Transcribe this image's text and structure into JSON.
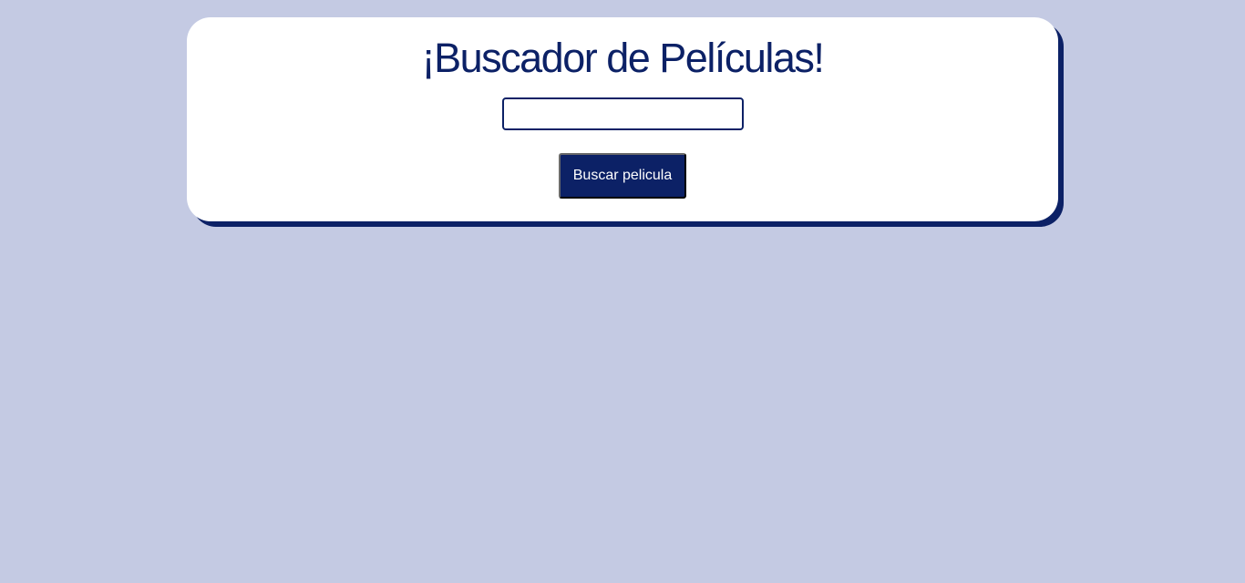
{
  "theme": {
    "background": "#c4cae3",
    "card_background": "#ffffff",
    "accent": "#0c2166",
    "button_text": "#ffffff"
  },
  "header": {
    "title": "¡Buscador de Películas!"
  },
  "search": {
    "value": "",
    "placeholder": ""
  },
  "actions": {
    "search_label": "Buscar pelicula"
  }
}
